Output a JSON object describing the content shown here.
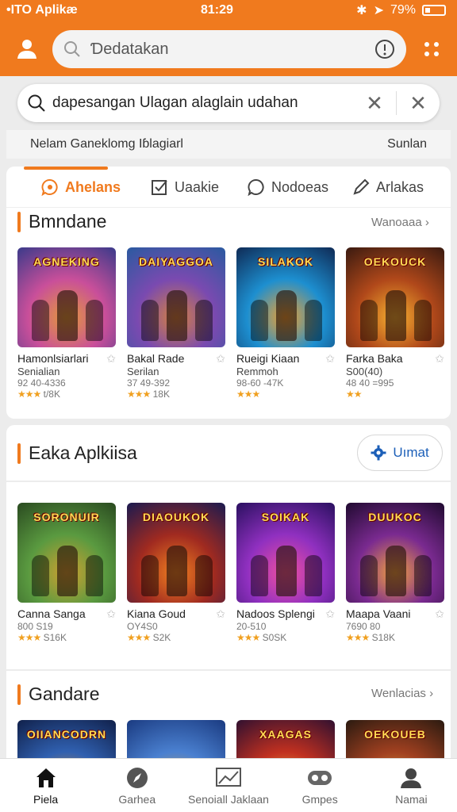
{
  "status": {
    "carrier": "•ΙΤΟ Aplikæ",
    "time": "81:29",
    "battery": "79%"
  },
  "appbar": {
    "search_placeholder": "Ɗedatakan"
  },
  "search": {
    "query": "dapesangan Ulagan alaglain udahan"
  },
  "subrow": {
    "left": "Nelam Ganeklomg Iɓlagiarl",
    "right": "Sunlan"
  },
  "tabs": [
    {
      "label": "Ahelans",
      "icon": "chat-icon"
    },
    {
      "label": "Uaakie",
      "icon": "check-square-icon"
    },
    {
      "label": "Nodoeas",
      "icon": "chat-bubble-icon"
    },
    {
      "label": "Arlakas",
      "icon": "pencil-icon"
    }
  ],
  "sections": [
    {
      "title": "Bmndane",
      "link": "Wanoaaa ›",
      "items": [
        {
          "name": "Hamonlsiarlari",
          "sub": "Senialian",
          "meta": "92 40-4336",
          "stars": "★★★",
          "rating": "t/8K",
          "art_title": "AGNEKING",
          "colors": [
            "#3a3a8a",
            "#c94f9a",
            "#e39a3a"
          ]
        },
        {
          "name": "Bakal Rade",
          "sub": "Serilan",
          "meta": "37 49-392",
          "stars": "★★★",
          "rating": "18K",
          "art_title": "DAIYAGGOA",
          "colors": [
            "#2a5aa0",
            "#7a4ab0",
            "#d48040"
          ]
        },
        {
          "name": "Rueigi Kiaan",
          "sub": "Remmoh",
          "meta": "98-60 -47K",
          "stars": "★★★",
          "rating": "",
          "art_title": "SILAKOK",
          "colors": [
            "#0f2a55",
            "#1d8fd0",
            "#f0a030"
          ]
        },
        {
          "name": "Farka Baka",
          "sub": "S00(40)",
          "meta": "48 40 =995",
          "stars": "★★",
          "rating": "",
          "art_title": "OEKOUCK",
          "colors": [
            "#3a1a10",
            "#b0481a",
            "#f5b030"
          ]
        }
      ]
    },
    {
      "title": "Eaka Aplkiisa",
      "link": "Uımat",
      "items": [
        {
          "name": "Canna Sanga",
          "sub": "",
          "meta": "800 S19",
          "stars": "★★★",
          "rating": "S16K",
          "art_title": "SORONUIR",
          "colors": [
            "#2a4a20",
            "#5a9a40",
            "#d0a030"
          ]
        },
        {
          "name": "Kiana Goud",
          "sub": "",
          "meta": "OY4S0",
          "stars": "★★★",
          "rating": "S2K",
          "art_title": "DIAOUKOK",
          "colors": [
            "#1a1a50",
            "#a02a20",
            "#f08020"
          ]
        },
        {
          "name": "Nadoos Splengi",
          "sub": "",
          "meta": "20-510",
          "stars": "★★★",
          "rating": "S0SK",
          "art_title": "SOIKAK",
          "colors": [
            "#2a1060",
            "#9030c0",
            "#f050a0"
          ]
        },
        {
          "name": "Maapa Vaani",
          "sub": "",
          "meta": "7690 80",
          "stars": "★★★",
          "rating": "S18K",
          "art_title": "DUUKOC",
          "colors": [
            "#200a30",
            "#7a2a90",
            "#f0a040"
          ]
        }
      ]
    },
    {
      "title": "Gandare",
      "link": "Wenlacias ›",
      "items": [
        {
          "art_title": "OIIANCODRN",
          "colors": [
            "#10204a",
            "#3060b0",
            "#d09040"
          ]
        },
        {
          "art_title": "",
          "colors": [
            "#1a3a80",
            "#4a80d0",
            "#c0a060"
          ]
        },
        {
          "art_title": "XAAGAS",
          "colors": [
            "#301030",
            "#c03020",
            "#f0b040"
          ]
        },
        {
          "art_title": "OEKOUEB",
          "colors": [
            "#2a1a10",
            "#a04020",
            "#e0a040"
          ]
        }
      ]
    }
  ],
  "bottom_nav": [
    {
      "label": "Piela",
      "icon": "home-icon",
      "active": true
    },
    {
      "label": "Garhea",
      "icon": "compass-icon",
      "active": false
    },
    {
      "label": "Senoiall Jaklaan",
      "icon": "image-frame-icon",
      "active": false
    },
    {
      "label": "Gmpes",
      "icon": "gamepad-icon",
      "active": false
    },
    {
      "label": "Namai",
      "icon": "profile-icon",
      "active": false
    }
  ],
  "theme": {
    "accent": "#f07a1e",
    "link": "#1c5fb8",
    "star": "#f0a020"
  }
}
